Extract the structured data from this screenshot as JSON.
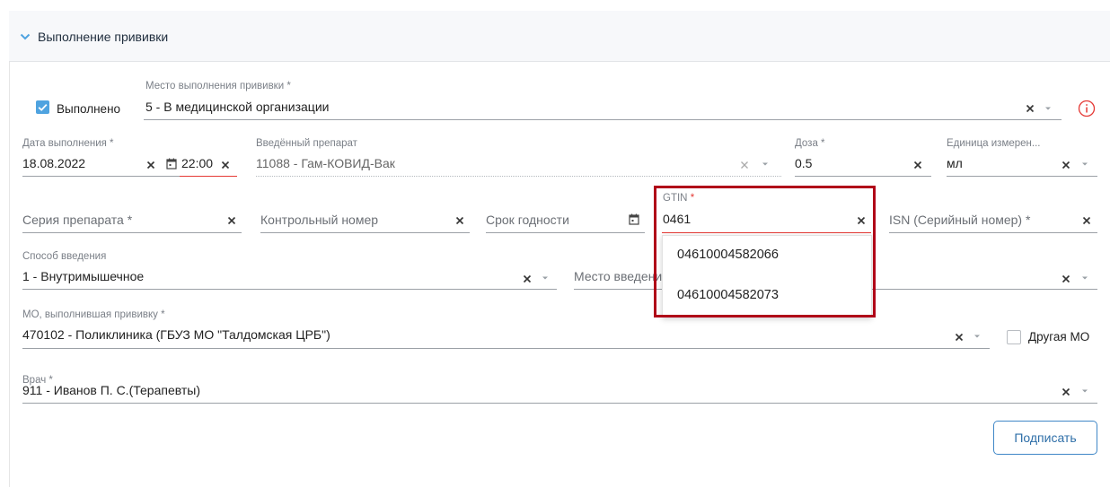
{
  "section": {
    "title": "Выполнение прививки"
  },
  "row1": {
    "done_label": "Выполнено",
    "place_label": "Место выполнения прививки *",
    "place_value": "5 - В медицинской организации"
  },
  "row2": {
    "date_label": "Дата выполнения *",
    "date_value": "18.08.2022",
    "time_value": "22:00",
    "drug_label": "Введённый препарат",
    "drug_value": "11088 - Гам-КОВИД-Вак",
    "dose_label": "Доза *",
    "dose_value": "0.5",
    "unit_label": "Единица измерен...",
    "unit_value": "мл"
  },
  "row3": {
    "series_placeholder": "Серия препарата *",
    "control_placeholder": "Контрольный номер",
    "expiry_placeholder": "Срок годности",
    "gtin_label": "GTIN",
    "gtin_required": "*",
    "gtin_value": "0461",
    "isn_placeholder": "ISN (Серийный номер) *"
  },
  "gtin_dropdown": {
    "options": [
      "04610004582066",
      "04610004582073"
    ]
  },
  "row4": {
    "route_label": "Способ введения",
    "route_value": "1 - Внутримышечное",
    "site_placeholder": "Место введения"
  },
  "row5": {
    "mo_label": "МО, выполнившая прививку *",
    "mo_value": "470102 - Поликлиника (ГБУЗ МО \"Талдомская ЦРБ\")",
    "other_mo_label": "Другая МО"
  },
  "row6": {
    "doctor_label": "Врач *",
    "doctor_value": "911 - Иванов П. С.(Терапевты)"
  },
  "actions": {
    "sign_label": "Подписать"
  },
  "colors": {
    "accent": "#4fa3e0",
    "highlight_border": "#b00018",
    "error_line": "#e53935",
    "info_icon": "#e53935",
    "button_border": "#3f87c7"
  },
  "icons": [
    "chevron-down-icon",
    "check-icon",
    "clear-icon",
    "caret-down-icon",
    "calendar-icon",
    "info-icon"
  ]
}
